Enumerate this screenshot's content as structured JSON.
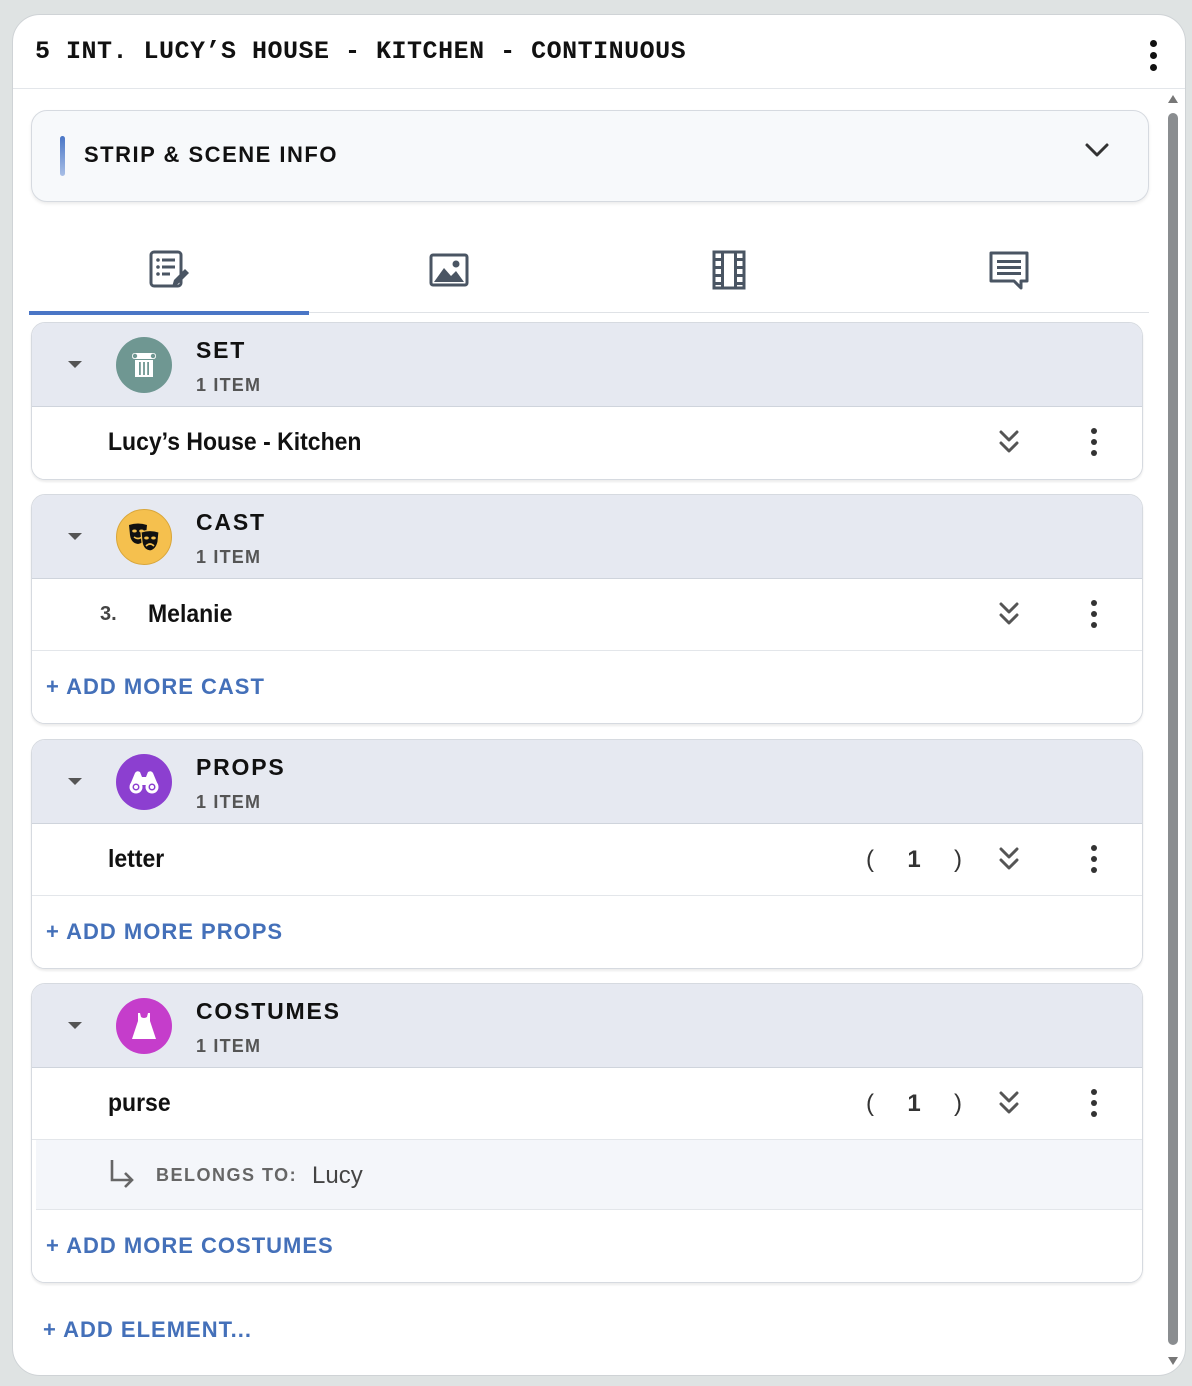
{
  "header": {
    "scene_title": "5 INT. LUCY’S HOUSE - KITCHEN - CONTINUOUS"
  },
  "strip_info": {
    "label": "STRIP & SCENE INFO"
  },
  "tabs": [
    {
      "name": "breakdown-tab",
      "icon": "list-edit-icon",
      "active": true
    },
    {
      "name": "image-tab",
      "icon": "image-icon",
      "active": false
    },
    {
      "name": "film-tab",
      "icon": "film-strip-icon",
      "active": false
    },
    {
      "name": "comments-tab",
      "icon": "comment-icon",
      "active": false
    }
  ],
  "sections": {
    "set": {
      "title": "SET",
      "count": "1 ITEM",
      "icon": "column-icon",
      "color": "#6f9792",
      "items": [
        {
          "name": "Lucy’s House - Kitchen"
        }
      ]
    },
    "cast": {
      "title": "CAST",
      "count": "1 ITEM",
      "icon": "theater-masks-icon",
      "color": "#f5c04e",
      "items": [
        {
          "number": "3.",
          "name": "Melanie"
        }
      ],
      "add_label": "+ ADD MORE CAST"
    },
    "props": {
      "title": "PROPS",
      "count": "1 ITEM",
      "icon": "binoculars-icon",
      "color": "#8c3fd0",
      "items": [
        {
          "name": "letter",
          "qty_open": "(",
          "qty": "1",
          "qty_close": ")"
        }
      ],
      "add_label": "+ ADD MORE PROPS"
    },
    "costumes": {
      "title": "COSTUMES",
      "count": "1 ITEM",
      "icon": "dress-icon",
      "color": "#c53dcb",
      "items": [
        {
          "name": "purse",
          "qty_open": "(",
          "qty": "1",
          "qty_close": ")",
          "belongs_label": "BELONGS TO:",
          "belongs_value": "Lucy"
        }
      ],
      "add_label": "+ ADD MORE COSTUMES"
    }
  },
  "footer": {
    "add_element_label": "+ ADD ELEMENT..."
  },
  "colors": {
    "accent": "#4a76c6",
    "link": "#4470b9",
    "section_header_bg": "#e6e9f1"
  }
}
